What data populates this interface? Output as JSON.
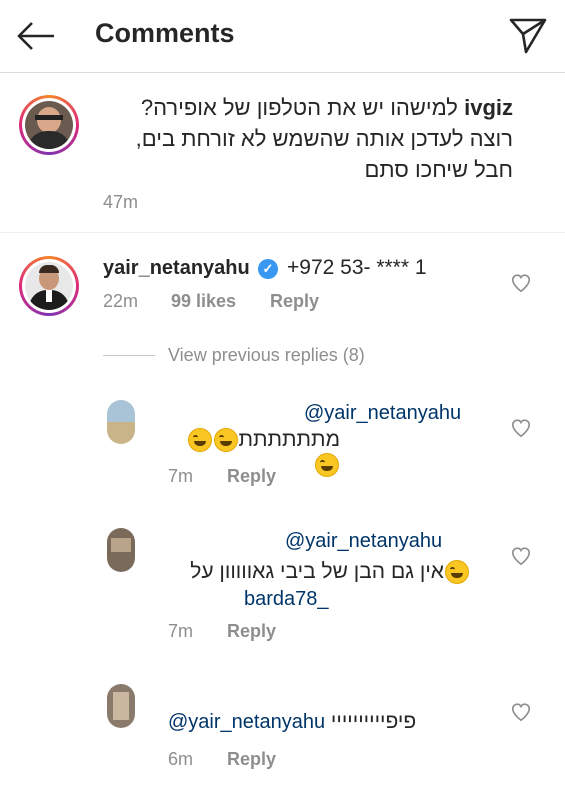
{
  "header": {
    "title": "Comments",
    "back_icon": "arrow-left-icon",
    "send_icon": "paper-plane-icon"
  },
  "caption": {
    "username": "ivgiz",
    "text": "למישהו יש את הטלפון של אופירה? רוצה לעדכן אותה שהשמש לא זורחת בים, חבל שיחכו סתם",
    "time": "47m"
  },
  "comment": {
    "username": "yair_netanyahu",
    "phone": "+972 53- **** 1",
    "time": "22m",
    "likes": "99 likes",
    "reply": "Reply",
    "view_previous": "View previous replies (8)"
  },
  "replies": [
    {
      "mention": "@yair_netanyahu",
      "text": "מתתתתתת",
      "time": "7m",
      "reply": "Reply"
    },
    {
      "mention": "@yair_netanyahu",
      "text": "אין גם הבן של ביבי גאווווון על",
      "mention2": "barda78_",
      "time": "7m",
      "reply": "Reply"
    },
    {
      "mention": "@yair_netanyahu",
      "text": "פיפיייייייייי",
      "time": "6m",
      "reply": "Reply"
    }
  ],
  "colors": {
    "link": "#003569",
    "meta": "#8e8e8e",
    "verified": "#3897f0"
  }
}
